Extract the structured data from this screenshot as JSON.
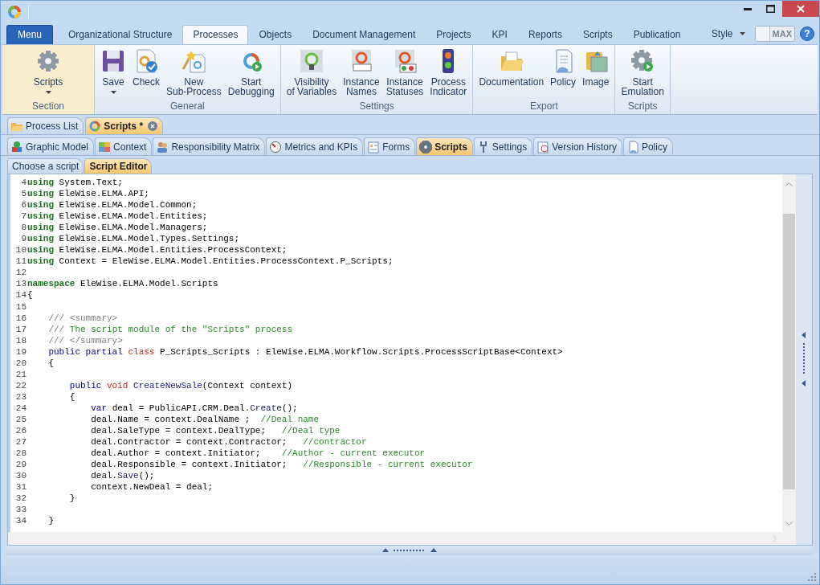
{
  "menu_button": {
    "label": "Menu"
  },
  "menu_tabs": [
    {
      "label": "Organizational Structure",
      "selected": false
    },
    {
      "label": "Processes",
      "selected": true
    },
    {
      "label": "Objects",
      "selected": false
    },
    {
      "label": "Document Management",
      "selected": false
    },
    {
      "label": "Projects",
      "selected": false
    },
    {
      "label": "KPI",
      "selected": false
    },
    {
      "label": "Reports",
      "selected": false
    },
    {
      "label": "Scripts",
      "selected": false
    },
    {
      "label": "Publication",
      "selected": false
    }
  ],
  "style_menu": {
    "label": "Style"
  },
  "max_toggle": {
    "label": "MAX",
    "on": false
  },
  "help_button": {
    "label": "?"
  },
  "ribbon_groups": [
    {
      "label": "Section",
      "selected": true,
      "buttons": [
        {
          "label": "Scripts",
          "dropdown": true
        }
      ]
    },
    {
      "label": "General",
      "selected": false,
      "buttons": [
        {
          "label": "Save",
          "dropdown": true
        },
        {
          "label": "Check",
          "dropdown": false
        },
        {
          "label": "New\nSub-Process",
          "dropdown": false
        },
        {
          "label": "Start\nDebugging",
          "dropdown": false
        }
      ]
    },
    {
      "label": "Settings",
      "selected": false,
      "buttons": [
        {
          "label": "Visibility\nof Variables",
          "dropdown": false
        },
        {
          "label": "Instance\nNames",
          "dropdown": false
        },
        {
          "label": "Instance\nStatuses",
          "dropdown": false
        },
        {
          "label": "Process\nIndicator",
          "dropdown": false
        }
      ]
    },
    {
      "label": "Export",
      "selected": false,
      "buttons": [
        {
          "label": "Documentation",
          "dropdown": false
        },
        {
          "label": "Policy",
          "dropdown": false
        },
        {
          "label": "Image",
          "dropdown": false
        }
      ]
    },
    {
      "label": "Scripts",
      "selected": false,
      "buttons": [
        {
          "label": "Start\nEmulation",
          "dropdown": false
        }
      ]
    }
  ],
  "document_tabs": [
    {
      "label": "Process List",
      "selected": false,
      "closable": false
    },
    {
      "label": "Scripts *",
      "selected": true,
      "closable": true
    }
  ],
  "section_tabs": [
    {
      "label": "Graphic Model",
      "selected": false
    },
    {
      "label": "Context",
      "selected": false
    },
    {
      "label": "Responsibility Matrix",
      "selected": false
    },
    {
      "label": "Metrics and KPIs",
      "selected": false
    },
    {
      "label": "Forms",
      "selected": false
    },
    {
      "label": "Scripts",
      "selected": true
    },
    {
      "label": "Settings",
      "selected": false
    },
    {
      "label": "Version History",
      "selected": false
    },
    {
      "label": "Policy",
      "selected": false
    }
  ],
  "script_tabs": [
    {
      "label": "Choose a script",
      "selected": false
    },
    {
      "label": "Script Editor",
      "selected": true
    }
  ],
  "code_lines": [
    {
      "number": "4",
      "tokens": [
        {
          "kind": "directive",
          "text": "using"
        },
        {
          "kind": "plain",
          "text": " System.Text;"
        }
      ]
    },
    {
      "number": "5",
      "tokens": [
        {
          "kind": "directive",
          "text": "using"
        },
        {
          "kind": "plain",
          "text": " EleWise.ELMA.API;"
        }
      ]
    },
    {
      "number": "6",
      "tokens": [
        {
          "kind": "directive",
          "text": "using"
        },
        {
          "kind": "plain",
          "text": " EleWise.ELMA.Model.Common;"
        }
      ]
    },
    {
      "number": "7",
      "tokens": [
        {
          "kind": "directive",
          "text": "using"
        },
        {
          "kind": "plain",
          "text": " EleWise.ELMA.Model.Entities;"
        }
      ]
    },
    {
      "number": "8",
      "tokens": [
        {
          "kind": "directive",
          "text": "using"
        },
        {
          "kind": "plain",
          "text": " EleWise.ELMA.Model.Managers;"
        }
      ]
    },
    {
      "number": "9",
      "tokens": [
        {
          "kind": "directive",
          "text": "using"
        },
        {
          "kind": "plain",
          "text": " EleWise.ELMA.Model.Types.Settings;"
        }
      ]
    },
    {
      "number": "10",
      "tokens": [
        {
          "kind": "directive",
          "text": "using"
        },
        {
          "kind": "plain",
          "text": " EleWise.ELMA.Model.Entities.ProcessContext;"
        }
      ]
    },
    {
      "number": "11",
      "tokens": [
        {
          "kind": "directive",
          "text": "using"
        },
        {
          "kind": "plain",
          "text": " Context = EleWise.ELMA.Model.Entities.ProcessContext.P_Scripts;"
        }
      ]
    },
    {
      "number": "12"
    },
    {
      "number": "13",
      "tokens": [
        {
          "kind": "directive",
          "text": "namespace"
        },
        {
          "kind": "plain",
          "text": " EleWise.ELMA.Model.Scripts"
        }
      ]
    },
    {
      "number": "14",
      "tokens": [
        {
          "kind": "plain",
          "text": "{"
        }
      ]
    },
    {
      "number": "15"
    },
    {
      "number": "16",
      "tokens": [
        {
          "kind": "doc",
          "text": "    /// <summary>"
        }
      ]
    },
    {
      "number": "17",
      "tokens": [
        {
          "kind": "doc",
          "text": "    ///"
        },
        {
          "kind": "comment",
          "text": " The script module of the \"Scripts\" process"
        }
      ]
    },
    {
      "number": "18",
      "tokens": [
        {
          "kind": "doc",
          "text": "    /// </summary>"
        }
      ]
    },
    {
      "number": "19",
      "tokens": [
        {
          "kind": "keyword",
          "text": "    public partial"
        },
        {
          "kind": "type",
          "text": " class"
        },
        {
          "kind": "plain",
          "text": " P_Scripts_Scripts : EleWise.ELMA.Workflow.Scripts.ProcessScriptBase<Context>"
        }
      ]
    },
    {
      "number": "20",
      "tokens": [
        {
          "kind": "plain",
          "text": "    {"
        }
      ]
    },
    {
      "number": "21"
    },
    {
      "number": "22",
      "tokens": [
        {
          "kind": "keyword",
          "text": "        public"
        },
        {
          "kind": "type",
          "text": " void"
        },
        {
          "kind": "method",
          "text": " CreateNewSale"
        },
        {
          "kind": "plain",
          "text": "(Context context)"
        }
      ]
    },
    {
      "number": "23",
      "tokens": [
        {
          "kind": "plain",
          "text": "        {"
        }
      ]
    },
    {
      "number": "24",
      "tokens": [
        {
          "kind": "keyword",
          "text": "            var"
        },
        {
          "kind": "plain",
          "text": " deal = PublicAPI.CRM.Deal."
        },
        {
          "kind": "method",
          "text": "Create"
        },
        {
          "kind": "plain",
          "text": "();"
        }
      ]
    },
    {
      "number": "25",
      "tokens": [
        {
          "kind": "plain",
          "text": "            deal.Name = context.DealName ;  "
        },
        {
          "kind": "comment",
          "text": "//Deal name"
        }
      ]
    },
    {
      "number": "26",
      "tokens": [
        {
          "kind": "plain",
          "text": "            deal.SaleType = context.DealType;   "
        },
        {
          "kind": "comment",
          "text": "//Deal type"
        }
      ]
    },
    {
      "number": "27",
      "tokens": [
        {
          "kind": "plain",
          "text": "            deal.Contractor = context.Contractor;   "
        },
        {
          "kind": "comment",
          "text": "//contractor"
        }
      ]
    },
    {
      "number": "28",
      "tokens": [
        {
          "kind": "plain",
          "text": "            deal.Author = context.Initiator;    "
        },
        {
          "kind": "comment",
          "text": "//Author - current executor"
        }
      ]
    },
    {
      "number": "29",
      "tokens": [
        {
          "kind": "plain",
          "text": "            deal.Responsible = context.Initiator;   "
        },
        {
          "kind": "comment",
          "text": "//Responsible - current executor"
        }
      ]
    },
    {
      "number": "30",
      "tokens": [
        {
          "kind": "plain",
          "text": "            deal."
        },
        {
          "kind": "method",
          "text": "Save"
        },
        {
          "kind": "plain",
          "text": "();"
        }
      ]
    },
    {
      "number": "31",
      "tokens": [
        {
          "kind": "plain",
          "text": "            context.NewDeal = deal;"
        }
      ]
    },
    {
      "number": "32",
      "tokens": [
        {
          "kind": "plain",
          "text": "        }"
        }
      ]
    },
    {
      "number": "33"
    },
    {
      "number": "34",
      "tokens": [
        {
          "kind": "plain",
          "text": "    }"
        }
      ]
    }
  ]
}
